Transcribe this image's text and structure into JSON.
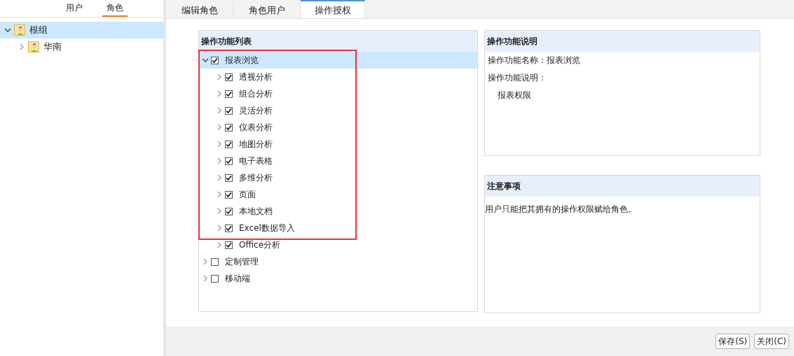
{
  "left_tabs": [
    {
      "label": "用户",
      "selected": false
    },
    {
      "label": "角色",
      "selected": true
    }
  ],
  "role_tree": [
    {
      "label": "根组",
      "expanded": true,
      "selected": true,
      "children": [
        {
          "label": "华南",
          "expanded": false,
          "selected": false
        }
      ]
    }
  ],
  "tabs": [
    {
      "label": "编辑角色",
      "selected": false
    },
    {
      "label": "角色用户",
      "selected": false
    },
    {
      "label": "操作授权",
      "selected": true
    }
  ],
  "function_list": {
    "title": "操作功能列表",
    "items": [
      {
        "label": "报表浏览",
        "checked": true,
        "expanded": true,
        "selected": true,
        "children": [
          {
            "label": "透视分析",
            "checked": true,
            "expanded": false,
            "selected": false
          },
          {
            "label": "组合分析",
            "checked": true,
            "expanded": false,
            "selected": false
          },
          {
            "label": "灵活分析",
            "checked": true,
            "expanded": false,
            "selected": false
          },
          {
            "label": "仪表分析",
            "checked": true,
            "expanded": false,
            "selected": false
          },
          {
            "label": "地图分析",
            "checked": true,
            "expanded": false,
            "selected": false
          },
          {
            "label": "电子表格",
            "checked": true,
            "expanded": false,
            "selected": false
          },
          {
            "label": "多维分析",
            "checked": true,
            "expanded": false,
            "selected": false
          },
          {
            "label": "页面",
            "checked": true,
            "expanded": false,
            "selected": false
          },
          {
            "label": "本地文档",
            "checked": true,
            "expanded": false,
            "selected": false
          },
          {
            "label": "Excel数据导入",
            "checked": true,
            "expanded": false,
            "selected": false
          },
          {
            "label": "Office分析",
            "checked": true,
            "expanded": false,
            "selected": false
          }
        ]
      },
      {
        "label": "定制管理",
        "checked": false,
        "expanded": false,
        "selected": false
      },
      {
        "label": "移动端",
        "checked": false,
        "expanded": false,
        "selected": false
      }
    ]
  },
  "description": {
    "title": "操作功能说明",
    "name_line": "操作功能名称：报表浏览",
    "desc_label": "操作功能说明：",
    "desc_value": "报表权限"
  },
  "notes": {
    "title": "注意事项",
    "text": "用户只能把其拥有的操作权限赋给角色。"
  },
  "buttons": [
    "保存(S)",
    "关闭(C)"
  ]
}
